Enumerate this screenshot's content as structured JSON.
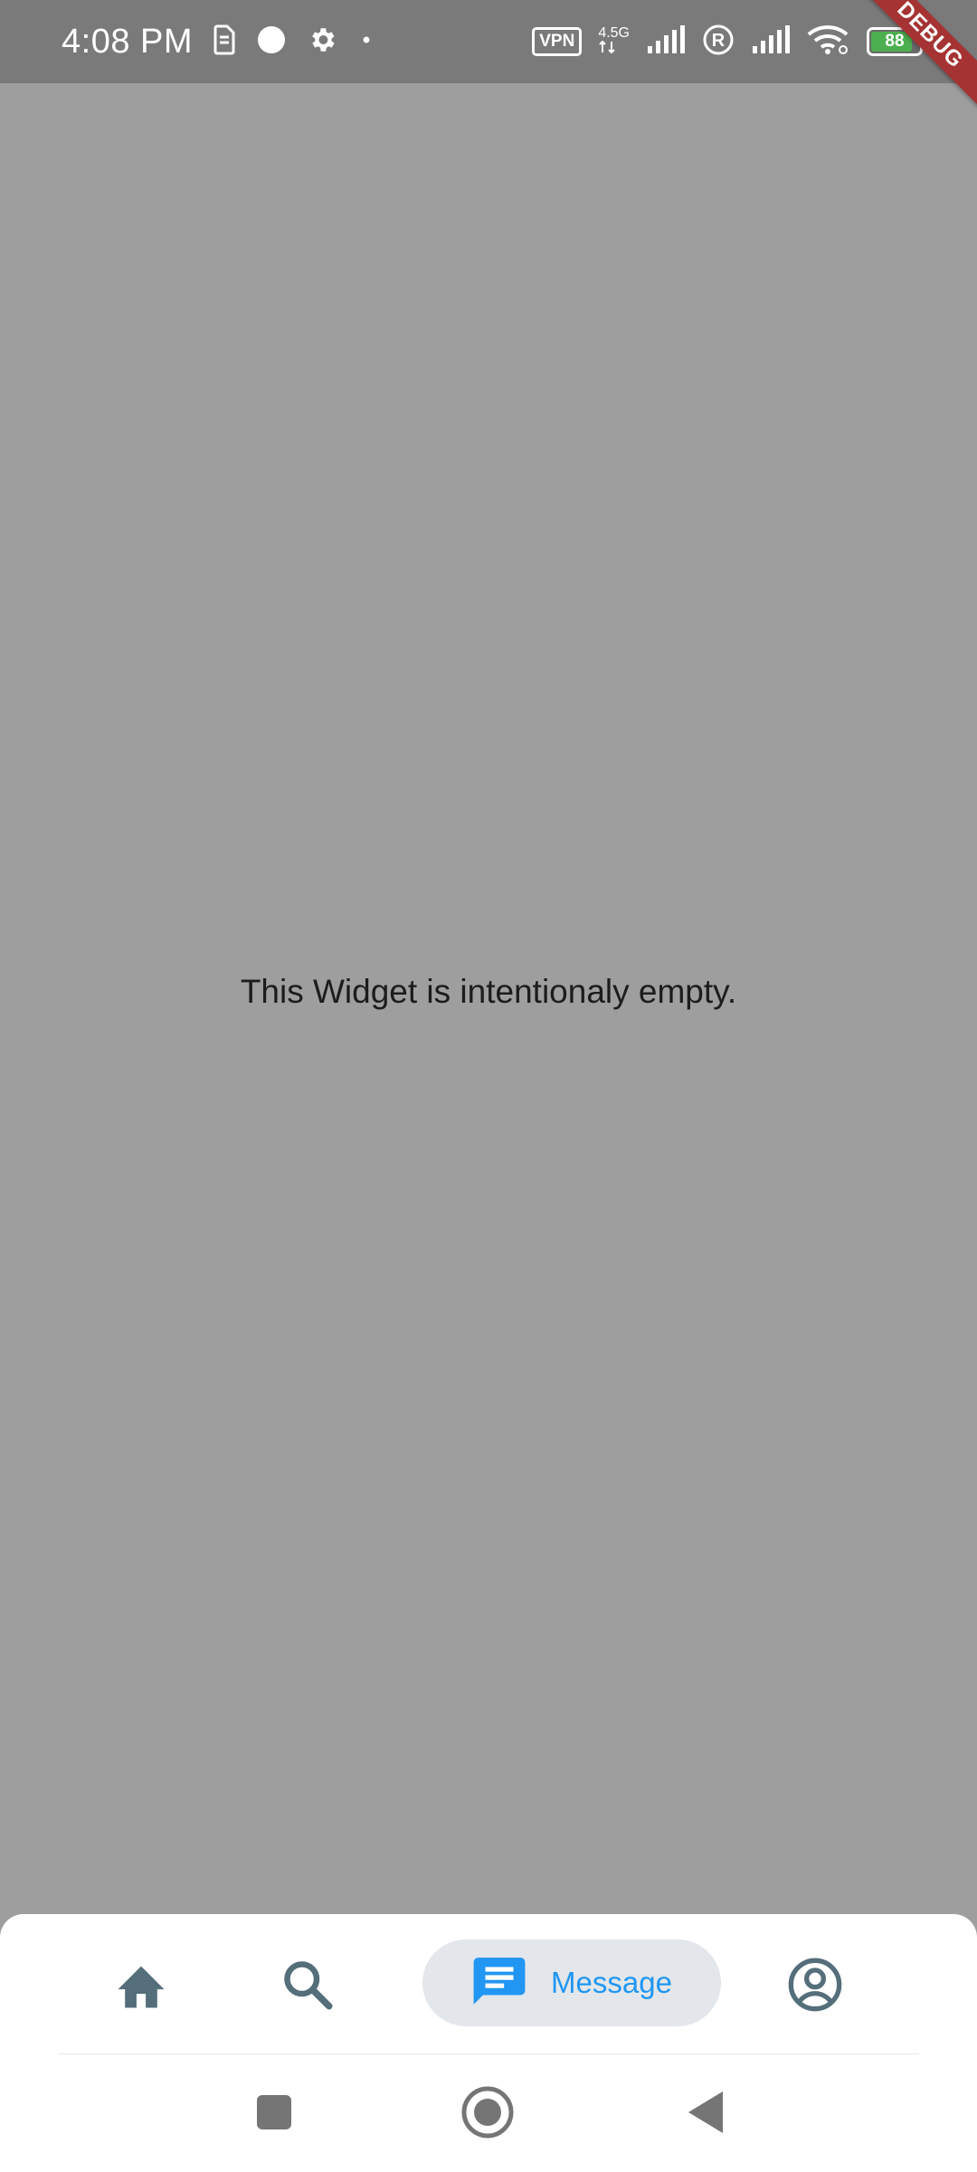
{
  "status_bar": {
    "time": "4:08 PM",
    "vpn": "VPN",
    "network_type": "4.5G",
    "battery_level": "88",
    "battery_fraction": 0.88,
    "icons": [
      "sim-icon",
      "notification-dot-icon",
      "gear-icon",
      "dot-icon",
      "vpn-icon",
      "signal-icon",
      "roaming-icon",
      "signal-icon",
      "wifi-icon",
      "battery-icon"
    ]
  },
  "debug_banner": "DEBUG",
  "main": {
    "empty_text": "This Widget is intentionaly empty."
  },
  "bottom_nav": {
    "items": [
      {
        "icon": "home-icon",
        "label": ""
      },
      {
        "icon": "search-icon",
        "label": ""
      },
      {
        "icon": "message-icon",
        "label": "Message",
        "selected": true
      },
      {
        "icon": "profile-icon",
        "label": ""
      }
    ],
    "active_color": "#2196f3",
    "inactive_color": "#546e7a",
    "pill_color": "#e3e7eb"
  },
  "system_nav": {
    "icons": [
      "recents-icon",
      "home-circle-icon",
      "back-icon"
    ]
  },
  "colors": {
    "status_bar": "#7a7a7a",
    "background": "#9e9e9e",
    "debug_banner": "#a53333",
    "battery_fill": "#4caf50"
  }
}
